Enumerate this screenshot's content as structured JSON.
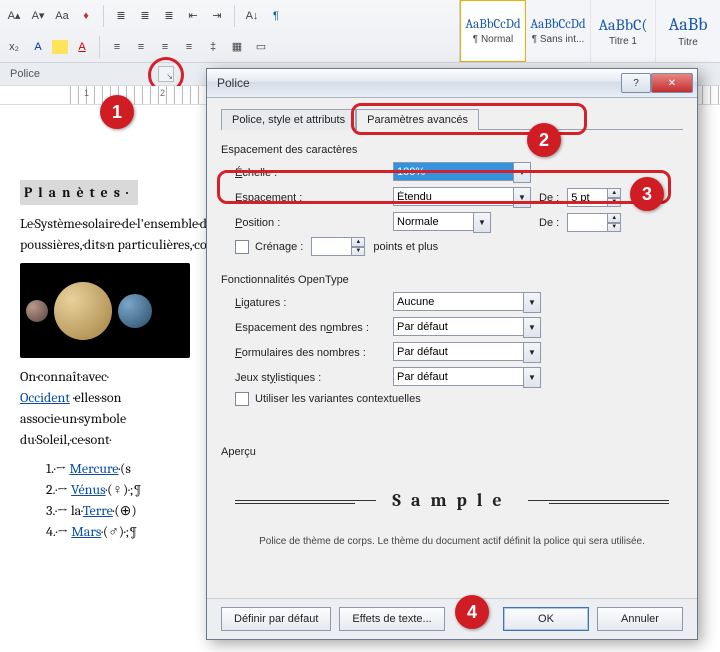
{
  "ribbon": {
    "styles": [
      {
        "sample": "AaBbCcDd",
        "label": "¶ Normal"
      },
      {
        "sample": "AaBbCcDd",
        "label": "¶ Sans int..."
      },
      {
        "sample": "AaBbC(",
        "label": "Titre 1"
      },
      {
        "sample": "AaBb",
        "label": "Titre"
      }
    ],
    "group_label": "Police"
  },
  "ruler_marks": [
    "1",
    "2"
  ],
  "document": {
    "title": "Planètes·",
    "p1": "Le·Système·solaire·de·l'ensemble·des·inclut·les·planètes, poussières,·dits·n particulières,·com",
    "p2_a": "On·connaît·avec·",
    "link_occident": "Occident",
    "p2_b": "·elles·son associe·un·symbole du·Soleil,·ce·sont·",
    "list": [
      {
        "n": "1.·→",
        "link": "Mercure",
        "after": "·(s"
      },
      {
        "n": "2.·→",
        "link": "Vénus",
        "after": "·(♀)·;¶"
      },
      {
        "n": "3.·→ la·",
        "link": "Terre",
        "after": "·(⊕)"
      },
      {
        "n": "4.·→",
        "link": "Mars",
        "after": "·(♂)·;¶"
      }
    ]
  },
  "dialog": {
    "title": "Police",
    "tab1": "Police, style et attributs",
    "tab2": "Paramètres avancés",
    "section_spacing": "Espacement des caractères",
    "scale_label": "Échelle :",
    "scale_value": "100%",
    "spacing_label": "Espacement :",
    "spacing_value": "Étendu",
    "by_label": "De :",
    "by_value": "5 pt",
    "position_label": "Position :",
    "position_value": "Normale",
    "position_by": "",
    "kerning_label": "Crénage :",
    "kerning_unit": "points et plus",
    "section_ot": "Fonctionnalités OpenType",
    "ligatures_label": "Ligatures :",
    "ligatures_value": "Aucune",
    "numspacing_label": "Espacement des nombres :",
    "numspacing_value": "Par défaut",
    "numforms_label": "Formulaires des nombres :",
    "numforms_value": "Par défaut",
    "stylistic_label": "Jeux stylistiques :",
    "stylistic_value": "Par défaut",
    "context_label": "Utiliser les variantes contextuelles",
    "preview_label": "Aperçu",
    "preview_text": "Sample",
    "preview_note": "Police de thème de corps. Le thème du document actif définit la police qui sera utilisée.",
    "btn_default": "Définir par défaut",
    "btn_effects": "Effets de texte...",
    "btn_ok": "OK",
    "btn_cancel": "Annuler"
  },
  "badges": {
    "b1": "1",
    "b2": "2",
    "b3": "3",
    "b4": "4"
  }
}
